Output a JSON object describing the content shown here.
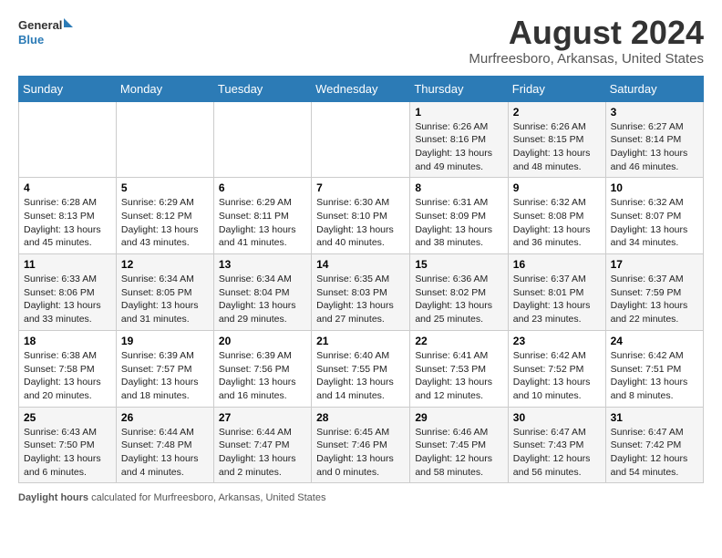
{
  "header": {
    "logo_line1": "General",
    "logo_line2": "Blue",
    "month_year": "August 2024",
    "location": "Murfreesboro, Arkansas, United States"
  },
  "days_of_week": [
    "Sunday",
    "Monday",
    "Tuesday",
    "Wednesday",
    "Thursday",
    "Friday",
    "Saturday"
  ],
  "weeks": [
    [
      {
        "day": "",
        "info": ""
      },
      {
        "day": "",
        "info": ""
      },
      {
        "day": "",
        "info": ""
      },
      {
        "day": "",
        "info": ""
      },
      {
        "day": "1",
        "info": "Sunrise: 6:26 AM\nSunset: 8:16 PM\nDaylight: 13 hours\nand 49 minutes."
      },
      {
        "day": "2",
        "info": "Sunrise: 6:26 AM\nSunset: 8:15 PM\nDaylight: 13 hours\nand 48 minutes."
      },
      {
        "day": "3",
        "info": "Sunrise: 6:27 AM\nSunset: 8:14 PM\nDaylight: 13 hours\nand 46 minutes."
      }
    ],
    [
      {
        "day": "4",
        "info": "Sunrise: 6:28 AM\nSunset: 8:13 PM\nDaylight: 13 hours\nand 45 minutes."
      },
      {
        "day": "5",
        "info": "Sunrise: 6:29 AM\nSunset: 8:12 PM\nDaylight: 13 hours\nand 43 minutes."
      },
      {
        "day": "6",
        "info": "Sunrise: 6:29 AM\nSunset: 8:11 PM\nDaylight: 13 hours\nand 41 minutes."
      },
      {
        "day": "7",
        "info": "Sunrise: 6:30 AM\nSunset: 8:10 PM\nDaylight: 13 hours\nand 40 minutes."
      },
      {
        "day": "8",
        "info": "Sunrise: 6:31 AM\nSunset: 8:09 PM\nDaylight: 13 hours\nand 38 minutes."
      },
      {
        "day": "9",
        "info": "Sunrise: 6:32 AM\nSunset: 8:08 PM\nDaylight: 13 hours\nand 36 minutes."
      },
      {
        "day": "10",
        "info": "Sunrise: 6:32 AM\nSunset: 8:07 PM\nDaylight: 13 hours\nand 34 minutes."
      }
    ],
    [
      {
        "day": "11",
        "info": "Sunrise: 6:33 AM\nSunset: 8:06 PM\nDaylight: 13 hours\nand 33 minutes."
      },
      {
        "day": "12",
        "info": "Sunrise: 6:34 AM\nSunset: 8:05 PM\nDaylight: 13 hours\nand 31 minutes."
      },
      {
        "day": "13",
        "info": "Sunrise: 6:34 AM\nSunset: 8:04 PM\nDaylight: 13 hours\nand 29 minutes."
      },
      {
        "day": "14",
        "info": "Sunrise: 6:35 AM\nSunset: 8:03 PM\nDaylight: 13 hours\nand 27 minutes."
      },
      {
        "day": "15",
        "info": "Sunrise: 6:36 AM\nSunset: 8:02 PM\nDaylight: 13 hours\nand 25 minutes."
      },
      {
        "day": "16",
        "info": "Sunrise: 6:37 AM\nSunset: 8:01 PM\nDaylight: 13 hours\nand 23 minutes."
      },
      {
        "day": "17",
        "info": "Sunrise: 6:37 AM\nSunset: 7:59 PM\nDaylight: 13 hours\nand 22 minutes."
      }
    ],
    [
      {
        "day": "18",
        "info": "Sunrise: 6:38 AM\nSunset: 7:58 PM\nDaylight: 13 hours\nand 20 minutes."
      },
      {
        "day": "19",
        "info": "Sunrise: 6:39 AM\nSunset: 7:57 PM\nDaylight: 13 hours\nand 18 minutes."
      },
      {
        "day": "20",
        "info": "Sunrise: 6:39 AM\nSunset: 7:56 PM\nDaylight: 13 hours\nand 16 minutes."
      },
      {
        "day": "21",
        "info": "Sunrise: 6:40 AM\nSunset: 7:55 PM\nDaylight: 13 hours\nand 14 minutes."
      },
      {
        "day": "22",
        "info": "Sunrise: 6:41 AM\nSunset: 7:53 PM\nDaylight: 13 hours\nand 12 minutes."
      },
      {
        "day": "23",
        "info": "Sunrise: 6:42 AM\nSunset: 7:52 PM\nDaylight: 13 hours\nand 10 minutes."
      },
      {
        "day": "24",
        "info": "Sunrise: 6:42 AM\nSunset: 7:51 PM\nDaylight: 13 hours\nand 8 minutes."
      }
    ],
    [
      {
        "day": "25",
        "info": "Sunrise: 6:43 AM\nSunset: 7:50 PM\nDaylight: 13 hours\nand 6 minutes."
      },
      {
        "day": "26",
        "info": "Sunrise: 6:44 AM\nSunset: 7:48 PM\nDaylight: 13 hours\nand 4 minutes."
      },
      {
        "day": "27",
        "info": "Sunrise: 6:44 AM\nSunset: 7:47 PM\nDaylight: 13 hours\nand 2 minutes."
      },
      {
        "day": "28",
        "info": "Sunrise: 6:45 AM\nSunset: 7:46 PM\nDaylight: 13 hours\nand 0 minutes."
      },
      {
        "day": "29",
        "info": "Sunrise: 6:46 AM\nSunset: 7:45 PM\nDaylight: 12 hours\nand 58 minutes."
      },
      {
        "day": "30",
        "info": "Sunrise: 6:47 AM\nSunset: 7:43 PM\nDaylight: 12 hours\nand 56 minutes."
      },
      {
        "day": "31",
        "info": "Sunrise: 6:47 AM\nSunset: 7:42 PM\nDaylight: 12 hours\nand 54 minutes."
      }
    ]
  ],
  "footer": {
    "label": "Daylight hours",
    "text": " calculated for Murfreesboro, Arkansas, United States"
  }
}
